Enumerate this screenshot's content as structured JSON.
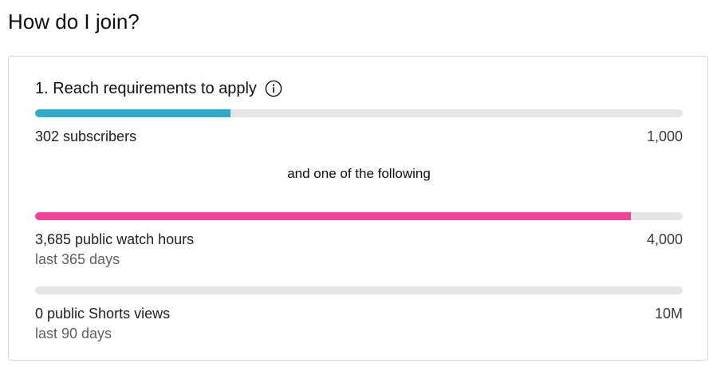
{
  "page": {
    "title": "How do I join?"
  },
  "card": {
    "heading": "1. Reach requirements to apply",
    "info_icon": "info-icon",
    "separator": "and one of the following"
  },
  "requirements": [
    {
      "label": "302 subscribers",
      "target": "1,000",
      "sublabel": "",
      "progress": 0.302,
      "color": "#33aacc"
    },
    {
      "label": "3,685 public watch hours",
      "target": "4,000",
      "sublabel": "last 365 days",
      "progress": 0.92,
      "color": "#ee4499"
    },
    {
      "label": "0 public Shorts views",
      "target": "10M",
      "sublabel": "last 90 days",
      "progress": 0,
      "color": "#ee4499"
    }
  ]
}
